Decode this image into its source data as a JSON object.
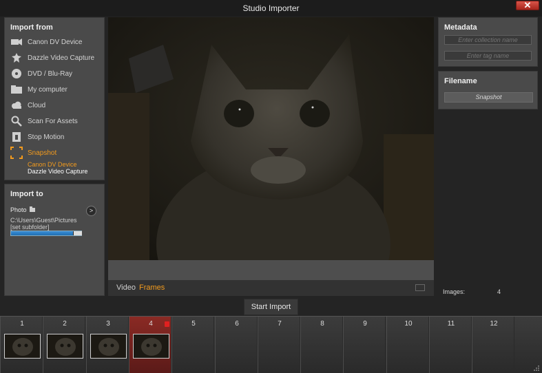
{
  "window": {
    "title": "Studio Importer",
    "close_glyph": "✕"
  },
  "import_from": {
    "title": "Import from",
    "items": [
      {
        "label": "Canon DV Device",
        "icon": "camcorder-icon"
      },
      {
        "label": "Dazzle Video Capture",
        "icon": "capture-device-icon"
      },
      {
        "label": "DVD / Blu-Ray",
        "icon": "disc-icon"
      },
      {
        "label": "My computer",
        "icon": "folder-icon"
      },
      {
        "label": "Cloud",
        "icon": "cloud-icon"
      },
      {
        "label": "Scan For Assets",
        "icon": "magnifier-icon"
      },
      {
        "label": "Stop Motion",
        "icon": "stop-motion-icon"
      },
      {
        "label": "Snapshot",
        "icon": "snapshot-icon"
      }
    ],
    "snapshot_devices": [
      "Canon DV Device",
      "Dazzle Video Capture"
    ]
  },
  "import_to": {
    "title": "Import to",
    "media_type": "Photo",
    "path": "C:\\Users\\Guest\\Pictures",
    "subfolder": "[set subfolder]",
    "capacity_fraction": 0.88
  },
  "preview": {
    "modes": {
      "video": "Video",
      "frames": "Frames"
    },
    "active_mode": "frames"
  },
  "metadata": {
    "title": "Metadata",
    "collection_placeholder": "Enter collection name",
    "tag_placeholder": "Enter tag name"
  },
  "filename": {
    "title": "Filename",
    "value": "Snapshot"
  },
  "images": {
    "label": "Images:",
    "count": "4"
  },
  "start_import": "Start Import",
  "tray": {
    "slots": [
      "1",
      "2",
      "3",
      "4",
      "5",
      "6",
      "7",
      "8",
      "9",
      "10",
      "11",
      "12"
    ],
    "filled_count": 4,
    "selected_index": 3
  },
  "colors": {
    "accent": "#f39b1d",
    "selection": "#8a2a24",
    "close": "#c0392b"
  }
}
